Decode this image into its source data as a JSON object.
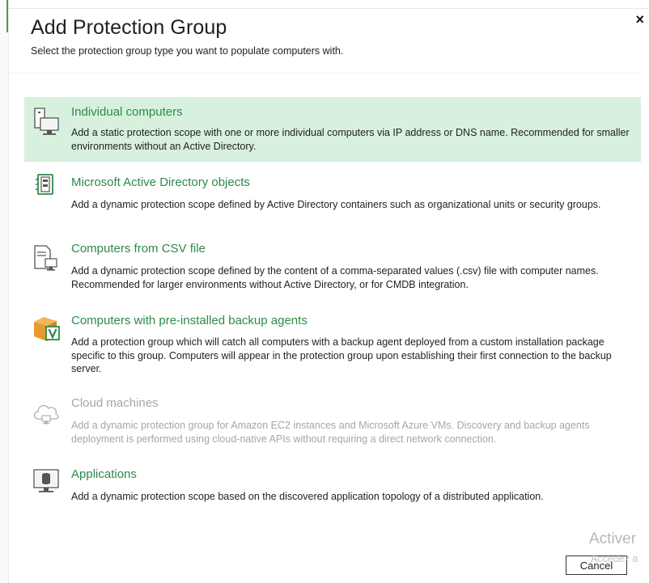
{
  "dialog": {
    "title": "Add Protection Group",
    "subtitle": "Select the protection group type you want to populate computers with.",
    "close_label": "×"
  },
  "options": [
    {
      "title": "Individual computers",
      "description": "Add a static protection scope with one or more individual computers via IP address or DNS name. Recommended for smaller environments without an Active Directory.",
      "icon": "computer-icon",
      "selected": true,
      "disabled": false
    },
    {
      "title": "Microsoft Active Directory objects",
      "description": "Add a dynamic protection scope defined by Active Directory containers such as organizational units or security groups.",
      "icon": "active-directory-icon",
      "selected": false,
      "disabled": false
    },
    {
      "title": "Computers from CSV file",
      "description": "Add a dynamic protection scope defined by the content of a comma-separated values (.csv) file with computer names. Recommended for larger environments without Active Directory, or for CMDB integration.",
      "icon": "csv-file-icon",
      "selected": false,
      "disabled": false
    },
    {
      "title": "Computers with pre-installed backup agents",
      "description": "Add a protection group which will catch all computers with a backup agent deployed from a custom installation package specific to this group. Computers will appear in the protection group upon establishing their first connection to the backup server.",
      "icon": "backup-agent-package-icon",
      "selected": false,
      "disabled": false
    },
    {
      "title": "Cloud machines",
      "description": "Add a dynamic protection group for Amazon EC2 instances and Microsoft Azure VMs. Discovery and backup agents deployment is performed using cloud-native APIs without requiring a direct network connection.",
      "icon": "cloud-icon",
      "selected": false,
      "disabled": true
    },
    {
      "title": "Applications",
      "description": "Add a dynamic protection scope based on the discovered application topology of a distributed application.",
      "icon": "application-icon",
      "selected": false,
      "disabled": false
    }
  ],
  "footer": {
    "cancel_label": "Cancel",
    "watermark_title": "Activer",
    "watermark_sub": "Accédez a"
  },
  "colors": {
    "accent_green": "#2d8a4a",
    "selected_bg": "#d7f1de",
    "disabled_text": "#a6a6a6"
  }
}
